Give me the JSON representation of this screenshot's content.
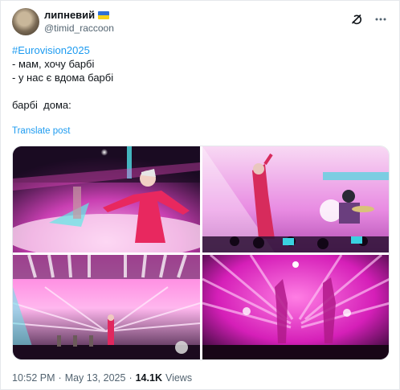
{
  "post": {
    "display_name": "липневий",
    "handle": "@timid_raccoon",
    "hashtag": "#Eurovision2025",
    "lines": [
      "- мам, хочу барбі",
      "- у нас є вдома барбі",
      "",
      "барбі  дома:"
    ],
    "translate_label": "Translate post",
    "time": "10:52 PM",
    "separator": "·",
    "date": "May 13, 2025",
    "views_count": "14.1K",
    "views_label": "Views"
  },
  "icons": {
    "grok": "grok-icon",
    "more": "more-icon",
    "flag": "ukraine-flag-icon"
  },
  "colors": {
    "accent": "#1d9bf0",
    "text": "#0f1419",
    "muted": "#536471",
    "stage_pink": "#ff3fc8"
  }
}
